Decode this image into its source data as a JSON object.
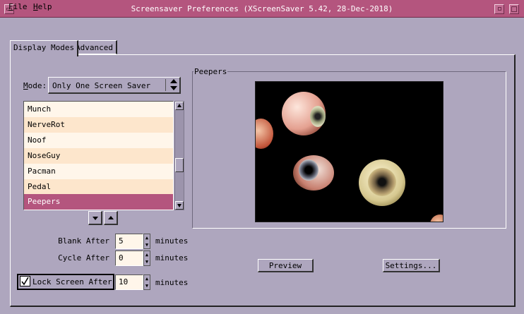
{
  "window": {
    "title": "Screensaver Preferences  (XScreenSaver 5.42, 28-Dec-2018)"
  },
  "menu": {
    "file": "File",
    "help": "Help"
  },
  "tabs": {
    "display_modes": "Display Modes",
    "advanced": "Advanced"
  },
  "mode": {
    "label": "Mode:",
    "value": "Only One Screen Saver"
  },
  "list": {
    "items": [
      "Munch",
      "NerveRot",
      "Noof",
      "NoseGuy",
      "Pacman",
      "Pedal",
      "Peepers"
    ],
    "selected": "Peepers"
  },
  "timing": {
    "blank_label": "Blank After",
    "blank_value": "5",
    "cycle_label": "Cycle After",
    "cycle_value": "0",
    "lock_label": "Lock Screen After",
    "lock_value": "10",
    "lock_checked": true,
    "unit": "minutes"
  },
  "preview": {
    "frame_label": "Peepers",
    "preview_button": "Preview",
    "settings_button": "Settings..."
  },
  "colors": {
    "accent": "#b4557e",
    "background": "#aea6be",
    "list_row_light": "#fff6ea",
    "list_row_dark": "#fde6cc"
  }
}
